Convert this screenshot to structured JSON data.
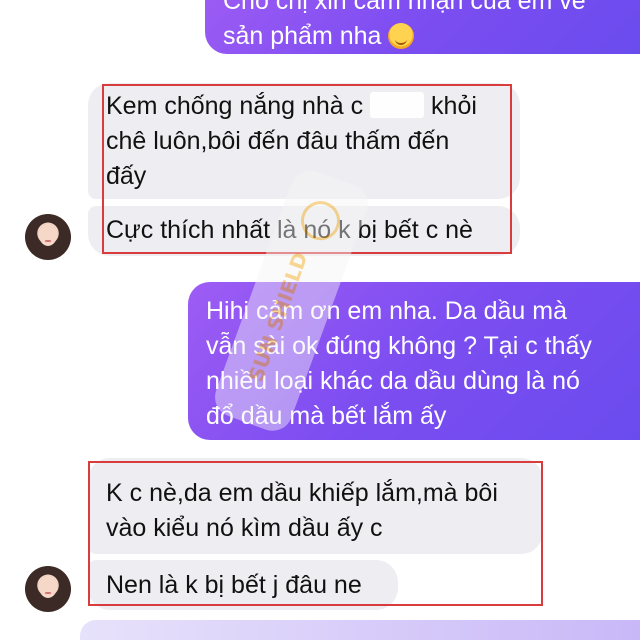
{
  "messages": {
    "top_out": {
      "line1": "Cho chị xin cảm nhận của em về",
      "line2": "sản phẩm nha",
      "emoji_icon": "smiling-face-with-hearts-icon"
    },
    "in1": {
      "line1_before": "Kem chống nắng nhà c",
      "line1_after": " khỏi",
      "line2": "chê luôn,bôi đến đâu thấm đến",
      "line3": "đấy"
    },
    "in2": "Cực thích nhất là nó k bị bết c nè",
    "out2": {
      "line1": "Hihi cảm ơn em nha. Da dầu mà",
      "line2": "vẫn sài ok đúng không ? Tại c thấy",
      "line3": "nhiều loại khác da dầu dùng là nó",
      "line4": "đổ dầu mà bết lắm ấy"
    },
    "in3": {
      "line1": "K c nè,da em dầu khiếp lắm,mà bôi",
      "line2": "vào kiểu nó kìm dầu ấy c"
    },
    "in4": "Nen là k bị bết j đâu ne"
  },
  "watermark": {
    "text": "SUN SHIELD"
  },
  "colors": {
    "incoming_bubble": "#eeeef2",
    "outgoing_start": "#9e5cf4",
    "outgoing_end": "#6a4cee",
    "highlight_border": "#d93c3c"
  }
}
